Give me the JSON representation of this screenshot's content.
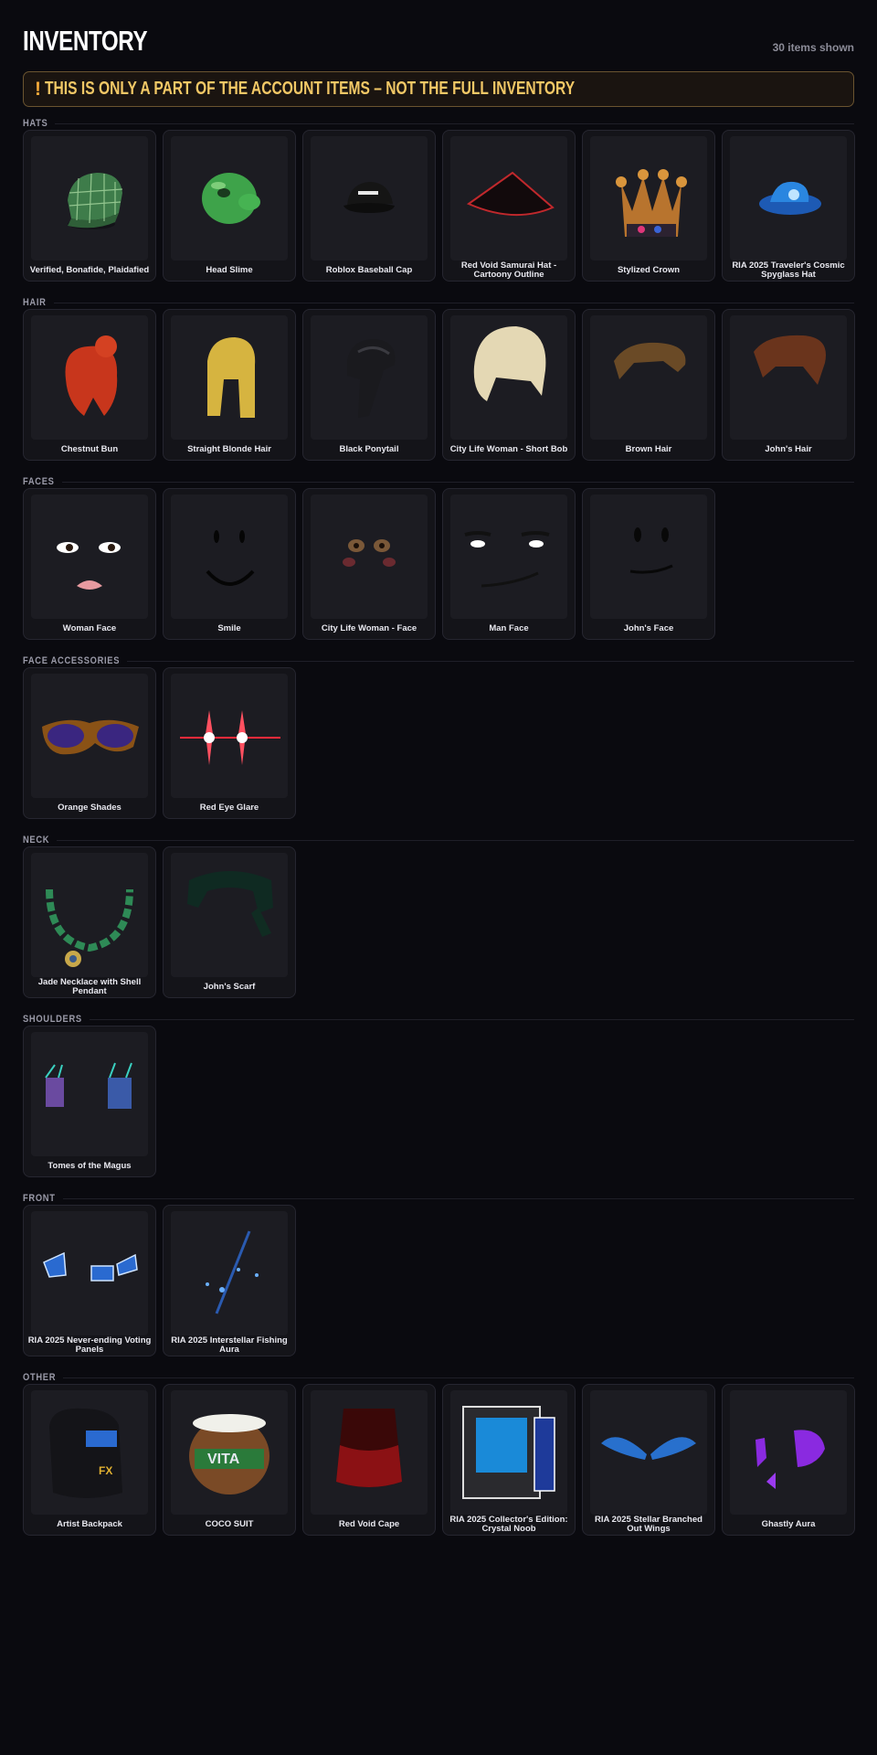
{
  "header": {
    "title": "INVENTORY",
    "count": "30 items shown"
  },
  "warning": {
    "icon": "!",
    "text": "THIS IS ONLY A PART OF THE ACCOUNT ITEMS – NOT THE FULL INVENTORY"
  },
  "sections": [
    {
      "label": "HATS",
      "items": [
        {
          "name": "Verified, Bonafide, Plaidafied",
          "icon": "plaid-cap-icon"
        },
        {
          "name": "Head Slime",
          "icon": "slime-icon"
        },
        {
          "name": "Roblox Baseball Cap",
          "icon": "baseball-cap-icon"
        },
        {
          "name": "Red Void Samurai Hat - Cartoony Outline",
          "icon": "samurai-hat-icon"
        },
        {
          "name": "Stylized Crown",
          "icon": "crown-icon"
        },
        {
          "name": "RIA 2025 Traveler's Cosmic Spyglass Hat",
          "icon": "cosmic-hat-icon"
        }
      ]
    },
    {
      "label": "HAIR",
      "items": [
        {
          "name": "Chestnut Bun",
          "icon": "red-hair-icon"
        },
        {
          "name": "Straight Blonde Hair",
          "icon": "blonde-hair-icon"
        },
        {
          "name": "Black Ponytail",
          "icon": "black-hair-icon"
        },
        {
          "name": "City Life Woman - Short Bob",
          "icon": "bob-hair-icon"
        },
        {
          "name": "Brown Hair",
          "icon": "brown-hair-icon"
        },
        {
          "name": "John's Hair",
          "icon": "johns-hair-icon"
        }
      ]
    },
    {
      "label": "FACES",
      "items": [
        {
          "name": "Woman Face",
          "icon": "woman-face-icon"
        },
        {
          "name": "Smile",
          "icon": "smile-face-icon"
        },
        {
          "name": "City Life Woman - Face",
          "icon": "city-face-icon"
        },
        {
          "name": "Man Face",
          "icon": "man-face-icon"
        },
        {
          "name": "John's Face",
          "icon": "johns-face-icon"
        }
      ]
    },
    {
      "label": "FACE ACCESSORIES",
      "items": [
        {
          "name": "Orange Shades",
          "icon": "shades-icon"
        },
        {
          "name": "Red Eye Glare",
          "icon": "eye-glare-icon"
        }
      ]
    },
    {
      "label": "NECK",
      "items": [
        {
          "name": "Jade Necklace with Shell Pendant",
          "icon": "necklace-icon"
        },
        {
          "name": "John's Scarf",
          "icon": "scarf-icon"
        }
      ]
    },
    {
      "label": "SHOULDERS",
      "items": [
        {
          "name": "Tomes of the Magus",
          "icon": "tomes-icon"
        }
      ]
    },
    {
      "label": "FRONT",
      "items": [
        {
          "name": "RIA 2025 Never-ending Voting Panels",
          "icon": "voting-panels-icon"
        },
        {
          "name": "RIA 2025 Interstellar Fishing Aura",
          "icon": "fishing-aura-icon"
        }
      ]
    },
    {
      "label": "OTHER",
      "items": [
        {
          "name": "Artist Backpack",
          "icon": "backpack-icon"
        },
        {
          "name": "COCO SUIT",
          "icon": "coconut-icon"
        },
        {
          "name": "Red Void Cape",
          "icon": "cape-icon"
        },
        {
          "name": "RIA 2025 Collector's Edition: Crystal Noob",
          "icon": "crystal-noob-icon"
        },
        {
          "name": "RIA 2025 Stellar Branched Out Wings",
          "icon": "wings-icon"
        },
        {
          "name": "Ghastly Aura",
          "icon": "ghastly-aura-icon"
        }
      ]
    }
  ],
  "colors": {
    "background": "#0a0a0f",
    "card": "#141419",
    "thumb": "#1c1c22",
    "warning_text": "#f2c866",
    "warning_icon": "#f2a93a"
  }
}
